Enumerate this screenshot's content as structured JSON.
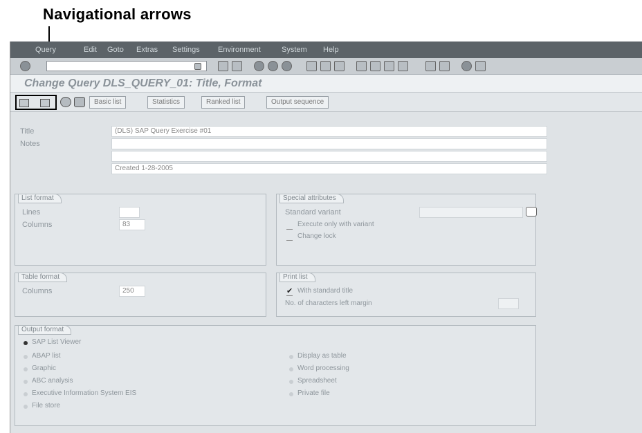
{
  "callout": {
    "text": "Navigational arrows"
  },
  "menubar": {
    "items": [
      "Query",
      "Edit",
      "Goto",
      "Extras",
      "Settings",
      "Environment",
      "System",
      "Help"
    ]
  },
  "title": "Change Query DLS_QUERY_01: Title, Format",
  "app_toolbar": {
    "buttons": [
      "Basic list",
      "Statistics",
      "Ranked list",
      "Output sequence"
    ]
  },
  "header": {
    "title_label": "Title",
    "title_value": "(DLS) SAP Query Exercise #01",
    "notes_label": "Notes",
    "notes_line1": "",
    "notes_line2": "",
    "notes_line3": "Created 1-28-2005"
  },
  "list_format": {
    "title": "List format",
    "lines_label": "Lines",
    "lines_value": "",
    "columns_label": "Columns",
    "columns_value": "83"
  },
  "special_attributes": {
    "title": "Special attributes",
    "standard_variant_label": "Standard variant",
    "standard_variant_value": "",
    "execute_variant_label": "Execute only with variant",
    "execute_variant_checked": false,
    "change_lock_label": "Change lock",
    "change_lock_checked": false
  },
  "table_format": {
    "title": "Table format",
    "columns_label": "Columns",
    "columns_value": "250"
  },
  "print_list": {
    "title": "Print list",
    "standard_title_label": "With standard title",
    "standard_title_checked": true,
    "left_margin_label": "No. of characters left margin",
    "left_margin_value": ""
  },
  "output_format": {
    "title": "Output format",
    "selected": "SAP List Viewer",
    "options_col1": [
      "SAP List Viewer",
      "ABAP list",
      "Graphic",
      "ABC analysis",
      "Executive Information System EIS",
      "File store"
    ],
    "options_col2": [
      "Display as table",
      "Word processing",
      "Spreadsheet",
      "Private file"
    ]
  }
}
